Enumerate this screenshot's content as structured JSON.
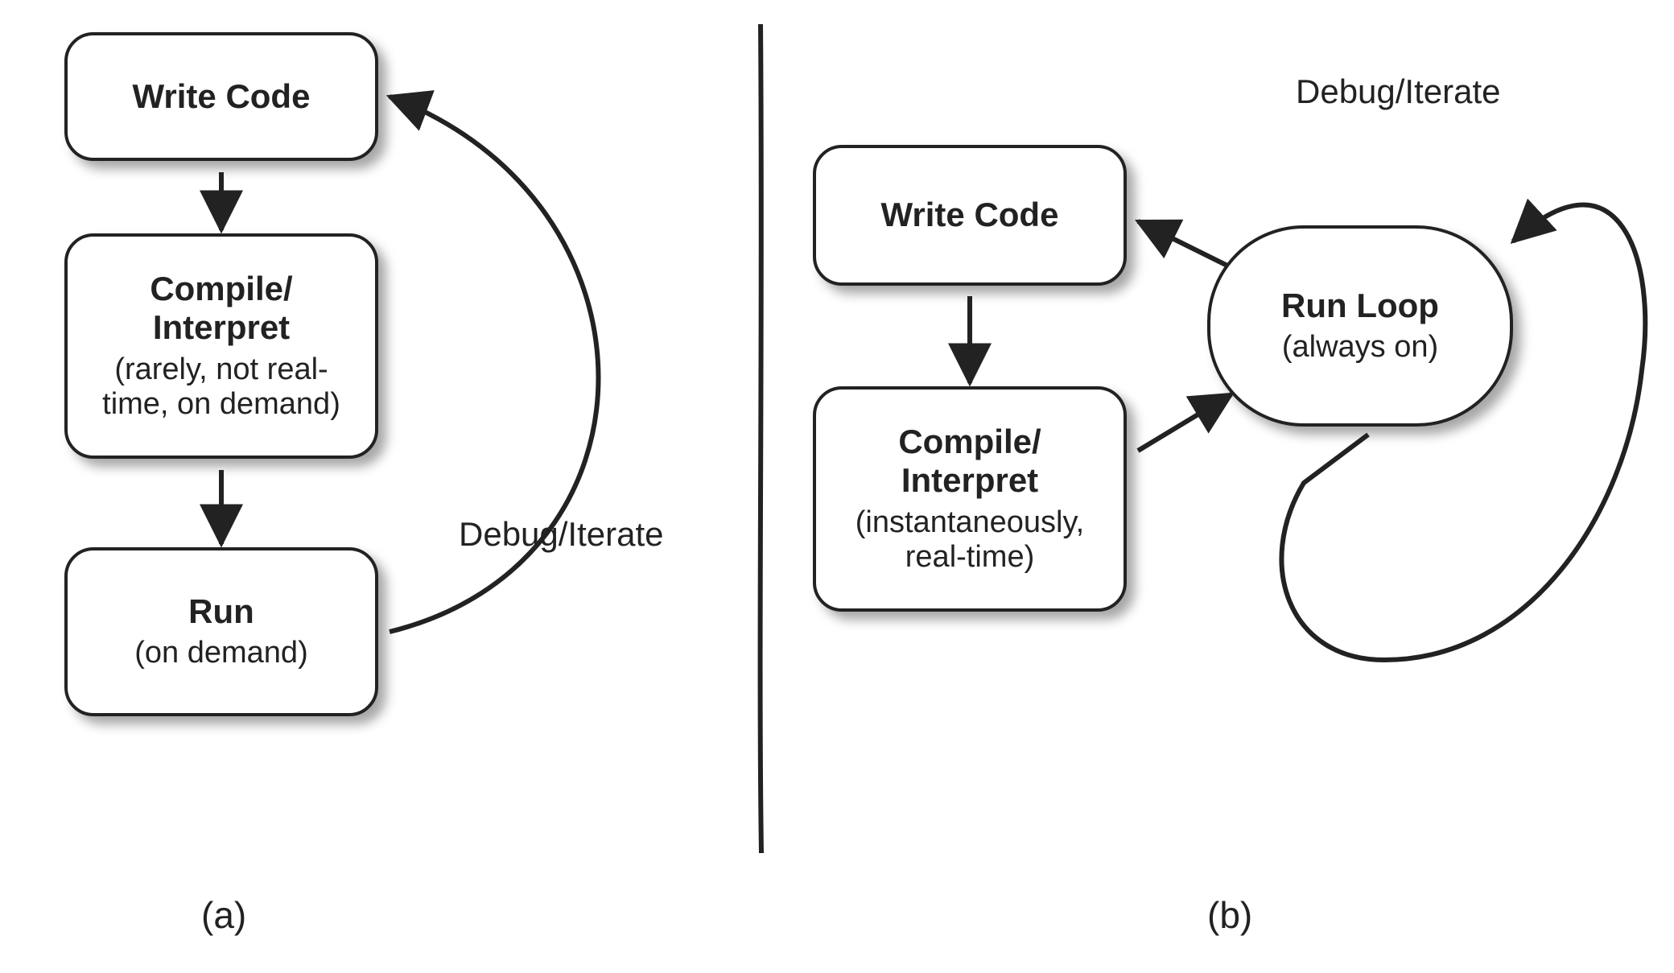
{
  "diagram_a": {
    "nodes": {
      "write": {
        "title": "Write Code"
      },
      "compile": {
        "title": "Compile/\nInterpret",
        "sub": "(rarely, not real-\ntime, on demand)"
      },
      "run": {
        "title": "Run",
        "sub": "(on demand)"
      }
    },
    "edge_label": "Debug/Iterate",
    "caption": "(a)"
  },
  "diagram_b": {
    "nodes": {
      "write": {
        "title": "Write Code"
      },
      "compile": {
        "title": "Compile/\nInterpret",
        "sub": "(instantaneously,\nreal-time)"
      },
      "runloop": {
        "title": "Run Loop",
        "sub": "(always on)"
      }
    },
    "edge_label": "Debug/Iterate",
    "caption": "(b)"
  }
}
